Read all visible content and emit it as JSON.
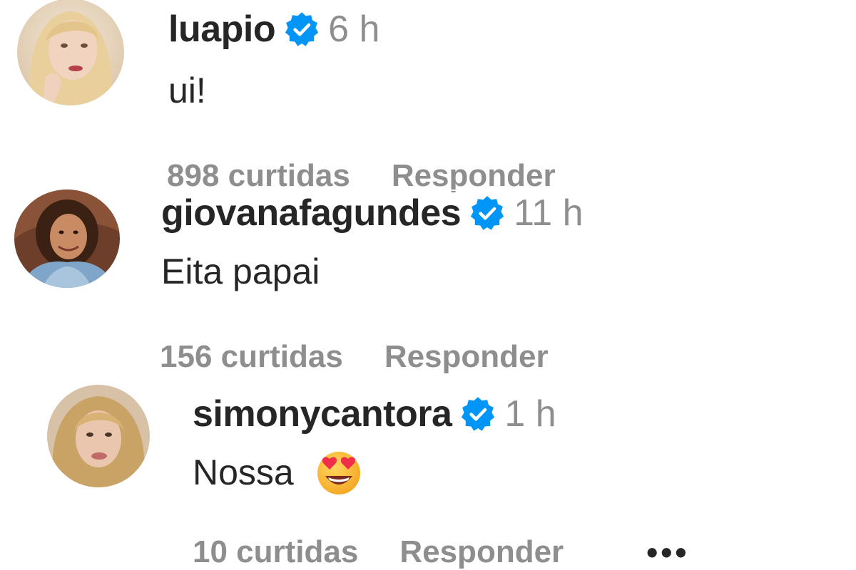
{
  "comments": [
    {
      "username": "luapio",
      "time": "6 h",
      "text": "ui!",
      "likes": "898 curtidas",
      "reply": "Responder",
      "verified": true,
      "avatar_icon": "profile-photo-blonde-woman"
    },
    {
      "username": "giovanafagundes",
      "time": "11 h",
      "text": "Eita papai",
      "likes": "156 curtidas",
      "reply": "Responder",
      "verified": true,
      "avatar_icon": "profile-photo-curly-hair-woman"
    },
    {
      "username": "simonycantora",
      "time": "1 h",
      "text": "Nossa",
      "emoji": "heart-eyes-emoji",
      "likes": "10 curtidas",
      "reply": "Responder",
      "more": "•••",
      "verified": true,
      "avatar_icon": "profile-photo-blonde-woman-selfie"
    }
  ],
  "colors": {
    "text": "#262626",
    "secondary": "#8e8e8e",
    "verified": "#0095f6",
    "background": "#ffffff"
  }
}
